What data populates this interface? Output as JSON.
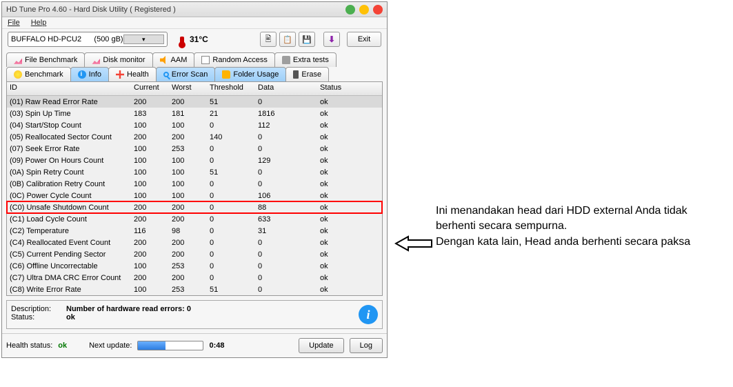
{
  "window": {
    "title": "HD Tune Pro 4.60 - Hard Disk Utility ( Registered )"
  },
  "menu": {
    "file": "File",
    "help": "Help"
  },
  "drive": {
    "selected": "BUFFALO HD-PCU2      (500 gB)"
  },
  "temperature": "31°C",
  "exit": "Exit",
  "tabs_row1": {
    "file_benchmark": "File Benchmark",
    "disk_monitor": "Disk monitor",
    "aam": "AAM",
    "random_access": "Random Access",
    "extra_tests": "Extra tests"
  },
  "tabs_row2": {
    "benchmark": "Benchmark",
    "info": "Info",
    "health": "Health",
    "error_scan": "Error Scan",
    "folder_usage": "Folder Usage",
    "erase": "Erase"
  },
  "grid": {
    "headers": {
      "id": "ID",
      "current": "Current",
      "worst": "Worst",
      "threshold": "Threshold",
      "data": "Data",
      "status": "Status"
    },
    "rows": [
      {
        "id": "(01) Raw Read Error Rate",
        "cur": "200",
        "worst": "200",
        "thr": "51",
        "data": "0",
        "status": "ok",
        "sel": true
      },
      {
        "id": "(03) Spin Up Time",
        "cur": "183",
        "worst": "181",
        "thr": "21",
        "data": "1816",
        "status": "ok"
      },
      {
        "id": "(04) Start/Stop Count",
        "cur": "100",
        "worst": "100",
        "thr": "0",
        "data": "112",
        "status": "ok"
      },
      {
        "id": "(05) Reallocated Sector Count",
        "cur": "200",
        "worst": "200",
        "thr": "140",
        "data": "0",
        "status": "ok"
      },
      {
        "id": "(07) Seek Error Rate",
        "cur": "100",
        "worst": "253",
        "thr": "0",
        "data": "0",
        "status": "ok"
      },
      {
        "id": "(09) Power On Hours Count",
        "cur": "100",
        "worst": "100",
        "thr": "0",
        "data": "129",
        "status": "ok"
      },
      {
        "id": "(0A) Spin Retry Count",
        "cur": "100",
        "worst": "100",
        "thr": "51",
        "data": "0",
        "status": "ok"
      },
      {
        "id": "(0B) Calibration Retry Count",
        "cur": "100",
        "worst": "100",
        "thr": "0",
        "data": "0",
        "status": "ok"
      },
      {
        "id": "(0C) Power Cycle Count",
        "cur": "100",
        "worst": "100",
        "thr": "0",
        "data": "106",
        "status": "ok"
      },
      {
        "id": "(C0) Unsafe Shutdown Count",
        "cur": "200",
        "worst": "200",
        "thr": "0",
        "data": "88",
        "status": "ok",
        "hl": true
      },
      {
        "id": "(C1) Load Cycle Count",
        "cur": "200",
        "worst": "200",
        "thr": "0",
        "data": "633",
        "status": "ok"
      },
      {
        "id": "(C2) Temperature",
        "cur": "116",
        "worst": "98",
        "thr": "0",
        "data": "31",
        "status": "ok"
      },
      {
        "id": "(C4) Reallocated Event Count",
        "cur": "200",
        "worst": "200",
        "thr": "0",
        "data": "0",
        "status": "ok"
      },
      {
        "id": "(C5) Current Pending Sector",
        "cur": "200",
        "worst": "200",
        "thr": "0",
        "data": "0",
        "status": "ok"
      },
      {
        "id": "(C6) Offline Uncorrectable",
        "cur": "100",
        "worst": "253",
        "thr": "0",
        "data": "0",
        "status": "ok"
      },
      {
        "id": "(C7) Ultra DMA CRC Error Count",
        "cur": "200",
        "worst": "200",
        "thr": "0",
        "data": "0",
        "status": "ok"
      },
      {
        "id": "(C8) Write Error Rate",
        "cur": "100",
        "worst": "253",
        "thr": "51",
        "data": "0",
        "status": "ok"
      }
    ]
  },
  "desc": {
    "label_description": "Description:",
    "label_status": "Status:",
    "description": "Number of hardware read errors: 0",
    "status": "ok"
  },
  "bottom": {
    "health_label": "Health status:",
    "health_value": "ok",
    "next_update_label": "Next update:",
    "next_update_value": "0:48",
    "update": "Update",
    "log": "Log",
    "progress_pct": 42
  },
  "annotation": "Ini menandakan head dari HDD external Anda tidak berhenti secara sempurna.\nDengan kata lain, Head anda berhenti secara paksa"
}
